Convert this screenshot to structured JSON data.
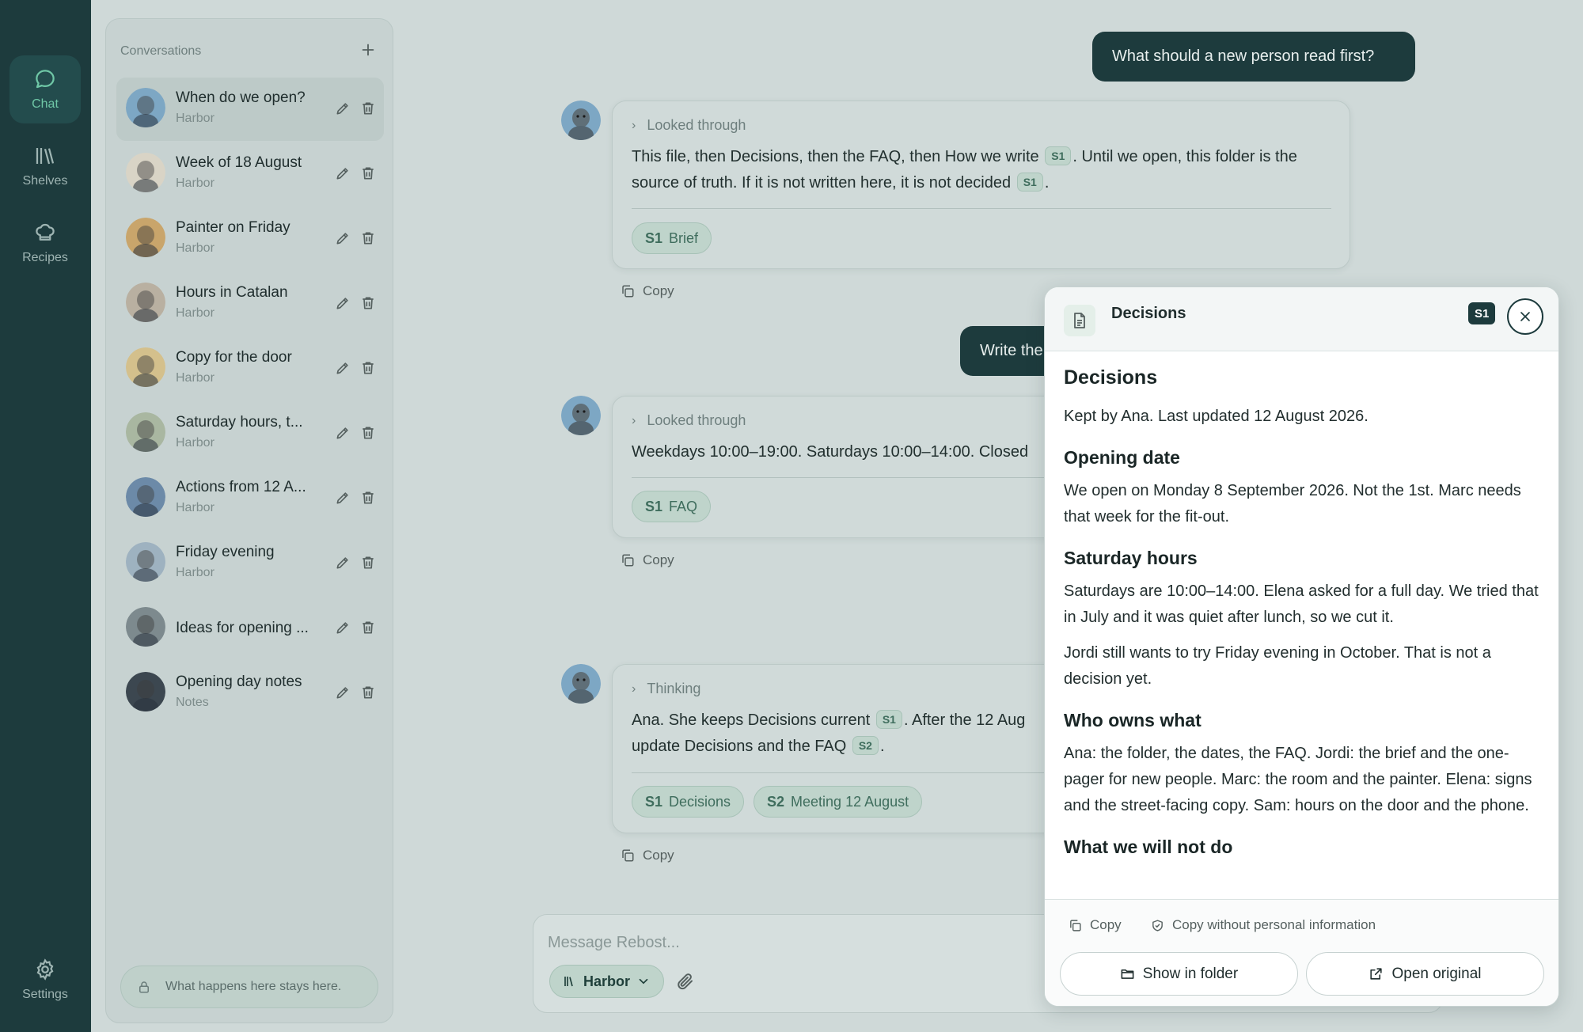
{
  "rail": {
    "items": [
      {
        "label": "Chat",
        "icon": "chat-bubble-icon",
        "active": true
      },
      {
        "label": "Shelves",
        "icon": "books-icon"
      },
      {
        "label": "Recipes",
        "icon": "chef-hat-icon"
      }
    ],
    "settings_label": "Settings"
  },
  "sidebar": {
    "title": "Conversations",
    "conversations": [
      {
        "title": "When do we open?",
        "shelf": "Harbor"
      },
      {
        "title": "Week of 18 August",
        "shelf": "Harbor"
      },
      {
        "title": "Painter on Friday",
        "shelf": "Harbor"
      },
      {
        "title": "Hours in Catalan",
        "shelf": "Harbor"
      },
      {
        "title": "Copy for the door",
        "shelf": "Harbor"
      },
      {
        "title": "Saturday hours, t...",
        "shelf": "Harbor"
      },
      {
        "title": "Actions from 12 A...",
        "shelf": "Harbor"
      },
      {
        "title": "Friday evening",
        "shelf": "Harbor"
      },
      {
        "title": "Ideas for opening ...",
        "shelf": ""
      },
      {
        "title": "Opening day notes",
        "shelf": "Notes"
      }
    ],
    "privacy_note": "What happens here stays here."
  },
  "chat": {
    "user_message_1": "What should a new person read first?",
    "user_message_2": "Write the",
    "reply_1": {
      "header": "Looked through",
      "text_a": "This file, then Decisions, then the FAQ, then How we write",
      "cite_a": "S1",
      "text_b": ". Until we open, this folder is the source of truth. If it is not written here, it is not decided",
      "cite_b": "S1",
      "text_c": ".",
      "chip_code": "S1",
      "chip_label": "Brief",
      "copy_label": "Copy"
    },
    "reply_2": {
      "header": "Looked through",
      "text": "Weekdays 10:00–19:00. Saturdays 10:00–14:00. Closed",
      "chip_code": "S1",
      "chip_label": "FAQ",
      "copy_label": "Copy"
    },
    "reply_3": {
      "header": "Thinking",
      "text_a": "Ana. She keeps Decisions current",
      "cite_a": "S1",
      "text_b": ". After the 12 Aug",
      "text_c": "update Decisions and the FAQ",
      "cite_b": "S2",
      "text_d": ".",
      "chip1_code": "S1",
      "chip1_label": "Decisions",
      "chip2_code": "S2",
      "chip2_label": "Meeting 12 August",
      "copy_label": "Copy"
    }
  },
  "composer": {
    "placeholder": "Message Rebost...",
    "shelf_label": "Harbor"
  },
  "panel": {
    "title": "Decisions",
    "badge": "S1",
    "doc_title": "Decisions",
    "meta": "Kept by Ana. Last updated 12 August 2026.",
    "sections": [
      {
        "heading": "Opening date",
        "paragraphs": [
          "We open on Monday 8 September 2026. Not the 1st. Marc needs that week for the fit-out."
        ]
      },
      {
        "heading": "Saturday hours",
        "paragraphs": [
          "Saturdays are 10:00–14:00. Elena asked for a full day. We tried that in July and it was quiet after lunch, so we cut it.",
          "Jordi still wants to try Friday evening in October. That is not a decision yet."
        ]
      },
      {
        "heading": "Who owns what",
        "paragraphs": [
          "Ana: the folder, the dates, the FAQ. Jordi: the brief and the one-pager for new people. Marc: the room and the painter. Elena: signs and the street-facing copy. Sam: hours on the door and the phone."
        ]
      },
      {
        "heading": "What we will not do",
        "paragraphs": []
      }
    ],
    "copy_label": "Copy",
    "copy_private_label": "Copy without personal information",
    "show_folder_label": "Show in folder",
    "open_original_label": "Open original"
  }
}
